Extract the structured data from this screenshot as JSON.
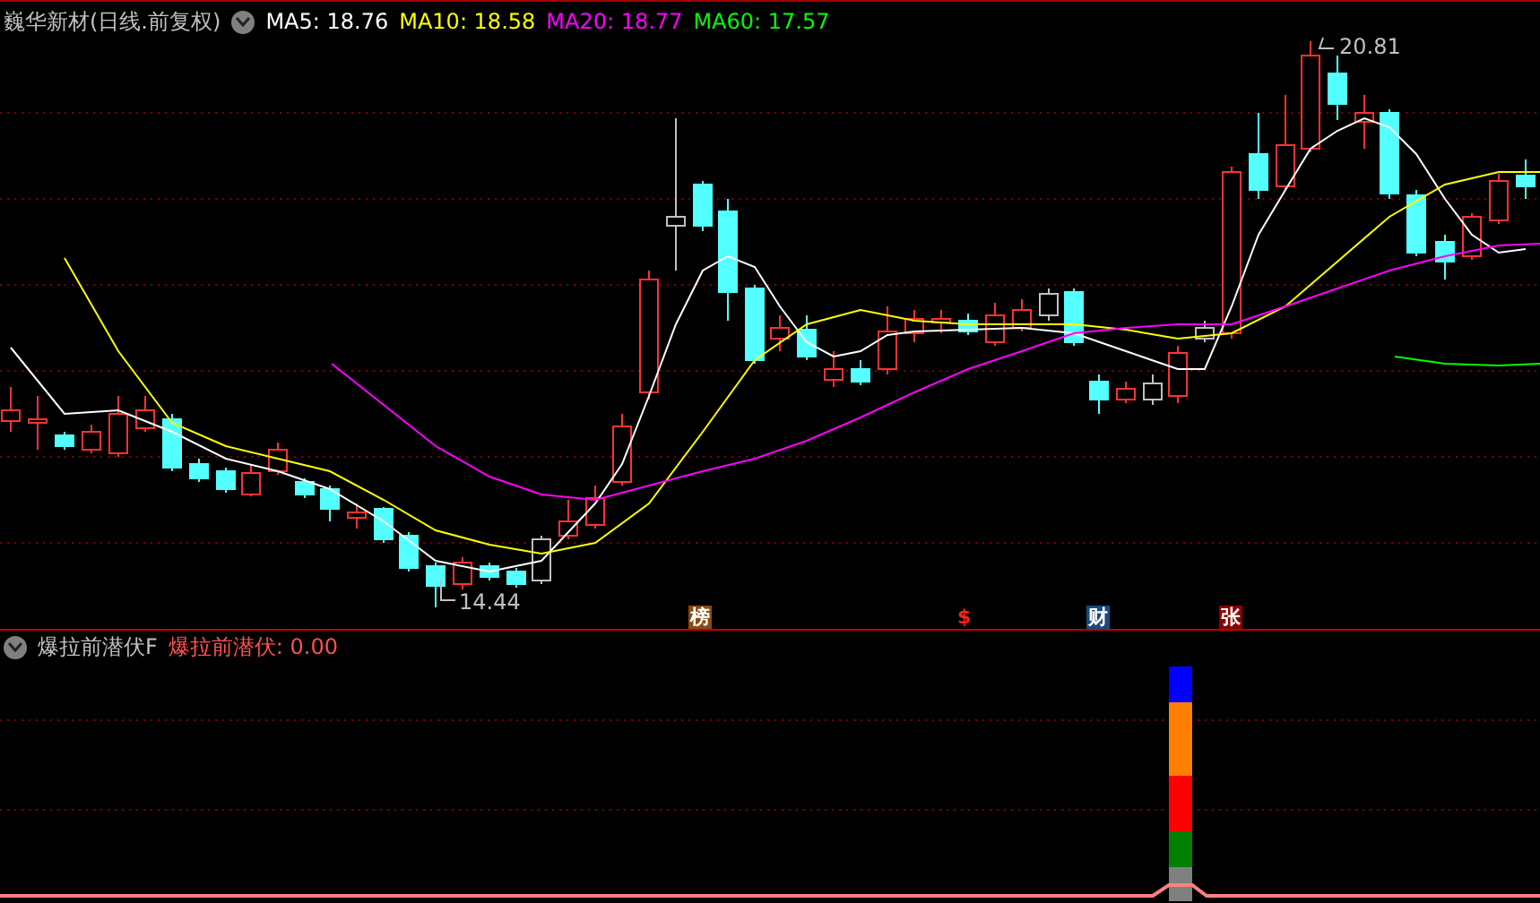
{
  "main_chart": {
    "title": "巍华新材(日线.前复权)",
    "moving_averages": [
      {
        "label": "MA5: 18.76",
        "color": "#ffffff"
      },
      {
        "label": "MA10: 18.58",
        "color": "#ffff00"
      },
      {
        "label": "MA20: 18.77",
        "color": "#ff00ff"
      },
      {
        "label": "MA60: 17.57",
        "color": "#00ff00"
      }
    ],
    "high_label": "20.81",
    "low_label": "14.44",
    "markers": [
      {
        "text": "榜",
        "color": "#8b4a0f"
      },
      {
        "text": "$",
        "color": "#000000"
      },
      {
        "text": "财",
        "color": "#1a4a7a"
      },
      {
        "text": "张",
        "color": "#8b0000"
      }
    ]
  },
  "indicator_panel": {
    "title": "爆拉前潜伏F",
    "series_label": "爆拉前潜伏: 0.00"
  }
}
